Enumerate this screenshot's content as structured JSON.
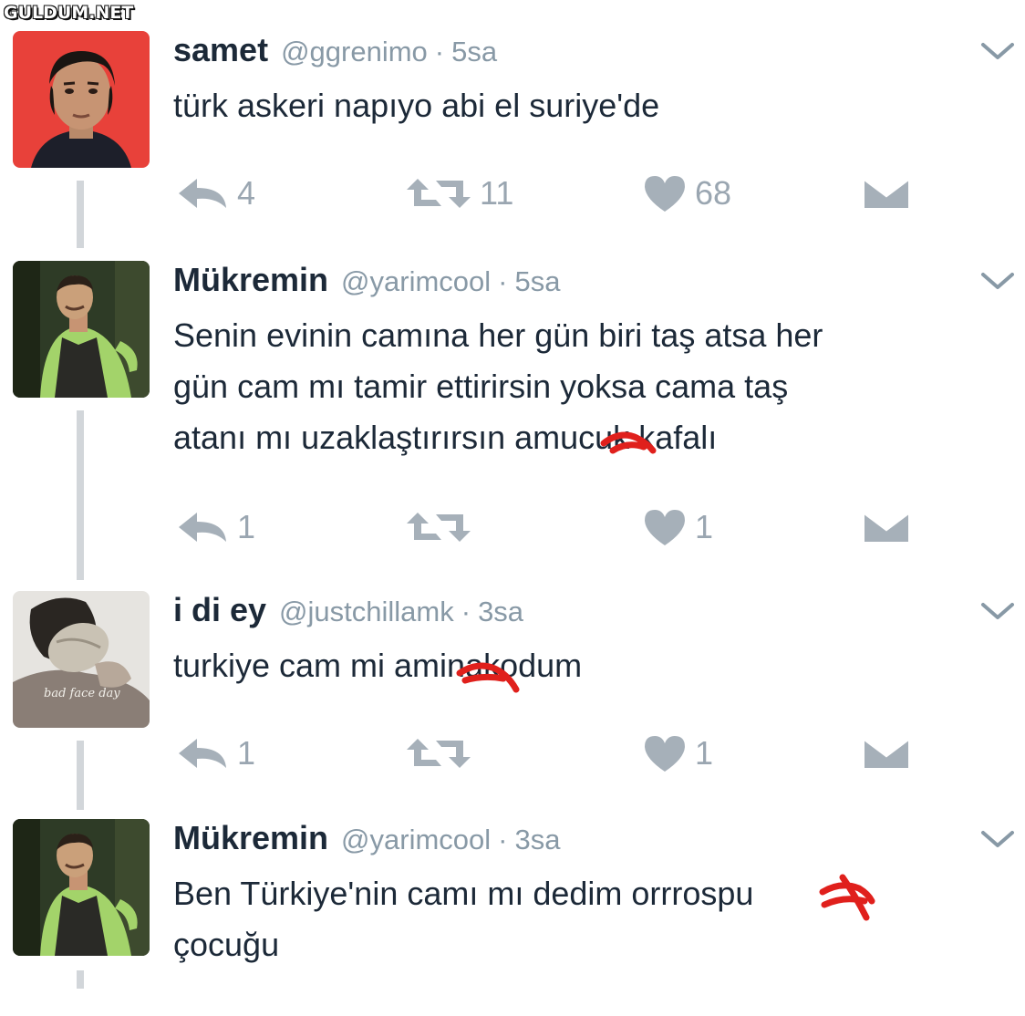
{
  "watermark": "GULDUM.NET",
  "tweets": [
    {
      "name": "samet",
      "handle": "@ggrenimo",
      "sep": "·",
      "time": "5sa",
      "text": "türk askeri napıyo abi el suriye'de",
      "avatar_icon": "profile-photo",
      "reply_count": "4",
      "retweet_count": "11",
      "like_count": "68"
    },
    {
      "name": "Mükremin",
      "handle": "@yarimcool",
      "sep": "·",
      "time": "5sa",
      "text": "Senin evinin camına her gün biri taş atsa her\ngün cam mı tamir ettirirsin yoksa cama taş\natanı mı uzaklaştırırsın amucuk kafalı",
      "avatar_icon": "profile-photo",
      "reply_count": "1",
      "retweet_count": "",
      "like_count": "1"
    },
    {
      "name": "i di ey",
      "handle": "@justchillamk",
      "sep": "·",
      "time": "3sa",
      "text": "turkiye cam mi aminakodum",
      "avatar_icon": "profile-photo",
      "avatar_caption": "bad face day",
      "reply_count": "1",
      "retweet_count": "",
      "like_count": "1"
    },
    {
      "name": "Mükremin",
      "handle": "@yarimcool",
      "sep": "·",
      "time": "3sa",
      "text": "Ben Türkiye'nin camı mı dedim orrrospu\nçocuğu",
      "avatar_icon": "profile-photo"
    }
  ],
  "colors": {
    "muted": "#8899a6",
    "icon": "#a6b0b9",
    "line": "#d2d6da",
    "censor": "#e0201c"
  }
}
